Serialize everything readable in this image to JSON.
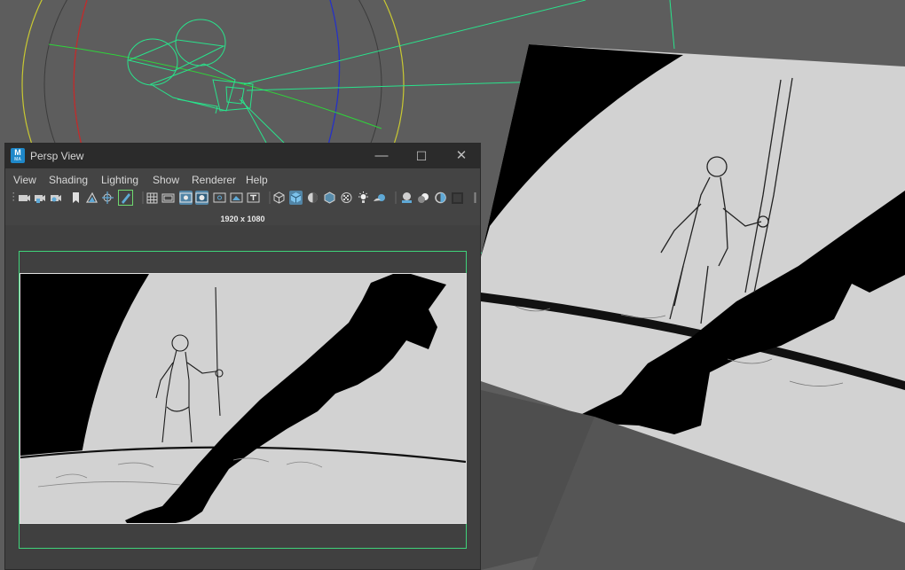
{
  "window": {
    "title": "Persp View",
    "app_badge": "M",
    "app_badge_sub": "MA",
    "minimize_glyph": "—",
    "maximize_glyph": "☐",
    "close_glyph": "✕"
  },
  "menu": [
    "View",
    "Shading",
    "Lighting",
    "Show",
    "Renderer",
    "Help"
  ],
  "resolution_label": "1920 x 1080",
  "colors": {
    "gate": "#3fd37a",
    "camera_wire": "#29e38c",
    "active_tool": "#5285a6",
    "titlebar": "#2b2b2b"
  }
}
